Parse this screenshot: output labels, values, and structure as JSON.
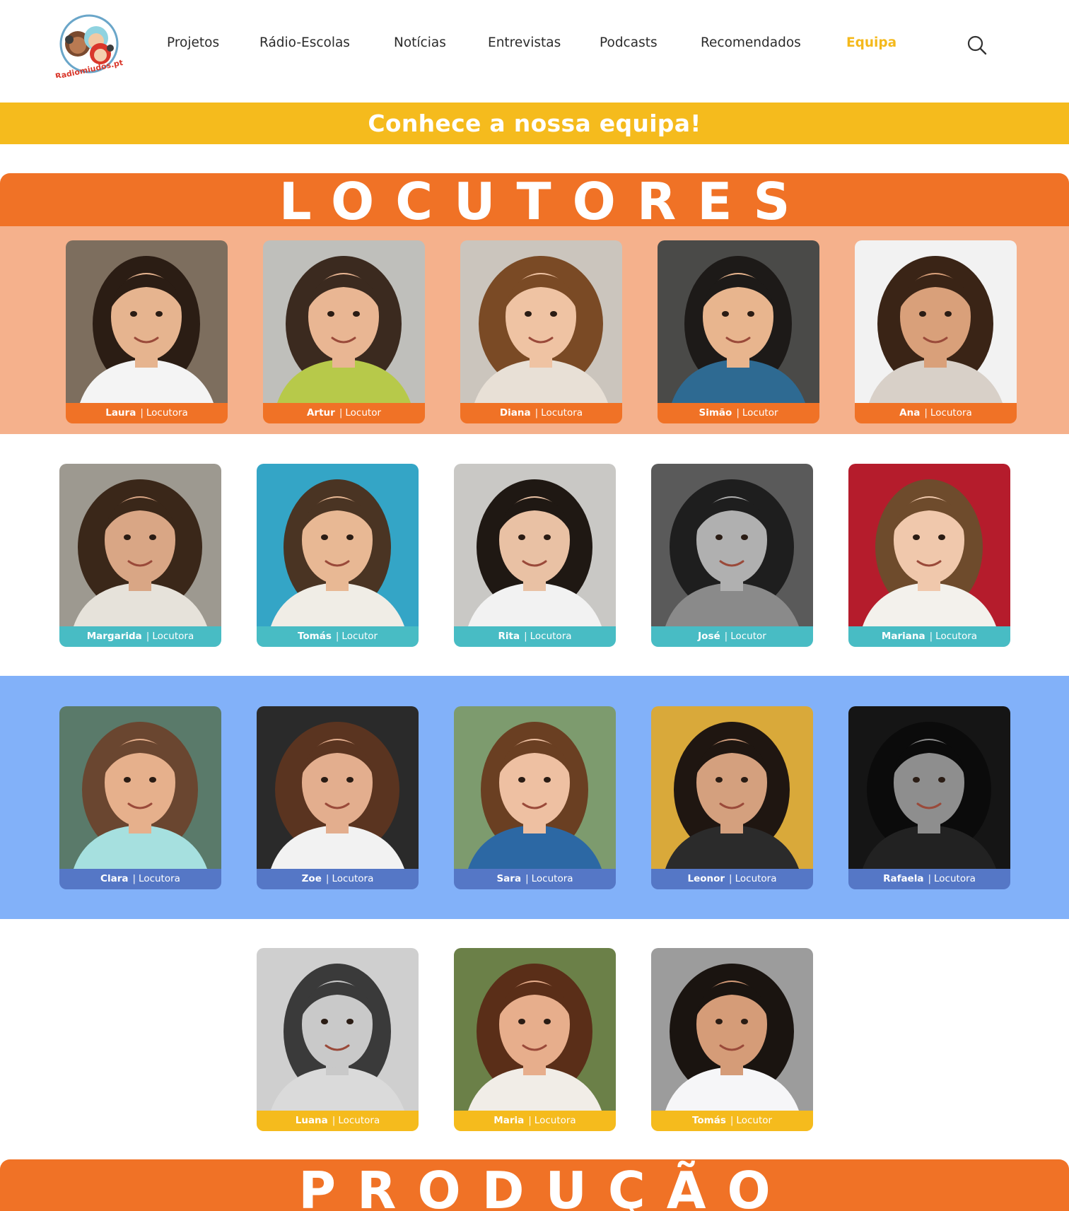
{
  "header": {
    "logo_text": "Radiomiudos.pt",
    "nav": [
      {
        "label": "Projetos",
        "active": false
      },
      {
        "label": "Rádio-Escolas",
        "active": false
      },
      {
        "label": "Notícias",
        "active": false
      },
      {
        "label": "Entrevistas",
        "active": false
      },
      {
        "label": "Podcasts",
        "active": false
      },
      {
        "label": "Recomendados",
        "active": false
      },
      {
        "label": "Equipa",
        "active": true
      }
    ],
    "search_icon": "search-icon"
  },
  "banner": {
    "title": "Conhece a nossa equipa!"
  },
  "sections": [
    {
      "title": "LOCUTORES"
    },
    {
      "title": "PRODUÇÃO"
    }
  ],
  "colors": {
    "banner": "#f5bb1d",
    "section_header": "#f07226",
    "row1_band": "#f5b18c",
    "row1_label": "#f07226",
    "row2_label": "#48bcc4",
    "row3_band": "#82b1f9",
    "row3_label": "#5577c6",
    "row4_label": "#f5bb1d",
    "nav_active": "#f4b91c"
  },
  "rows": [
    {
      "members": [
        {
          "name": "Laura",
          "role": "Locutora"
        },
        {
          "name": "Artur",
          "role": "Locutor"
        },
        {
          "name": "Diana",
          "role": "Locutora"
        },
        {
          "name": "Simão",
          "role": "Locutor"
        },
        {
          "name": "Ana",
          "role": "Locutora"
        }
      ]
    },
    {
      "members": [
        {
          "name": "Margarida",
          "role": "Locutora"
        },
        {
          "name": "Tomás",
          "role": "Locutor"
        },
        {
          "name": "Rita",
          "role": "Locutora"
        },
        {
          "name": "José",
          "role": "Locutor"
        },
        {
          "name": "Mariana",
          "role": "Locutora"
        }
      ]
    },
    {
      "members": [
        {
          "name": "Clara",
          "role": "Locutora"
        },
        {
          "name": "Zoe",
          "role": "Locutora"
        },
        {
          "name": "Sara",
          "role": "Locutora"
        },
        {
          "name": "Leonor",
          "role": "Locutora"
        },
        {
          "name": "Rafaela",
          "role": "Locutora"
        }
      ]
    },
    {
      "members": [
        {
          "name": "Luana",
          "role": "Locutora"
        },
        {
          "name": "Maria",
          "role": "Locutora"
        },
        {
          "name": "Tomás",
          "role": "Locutor"
        }
      ]
    }
  ]
}
